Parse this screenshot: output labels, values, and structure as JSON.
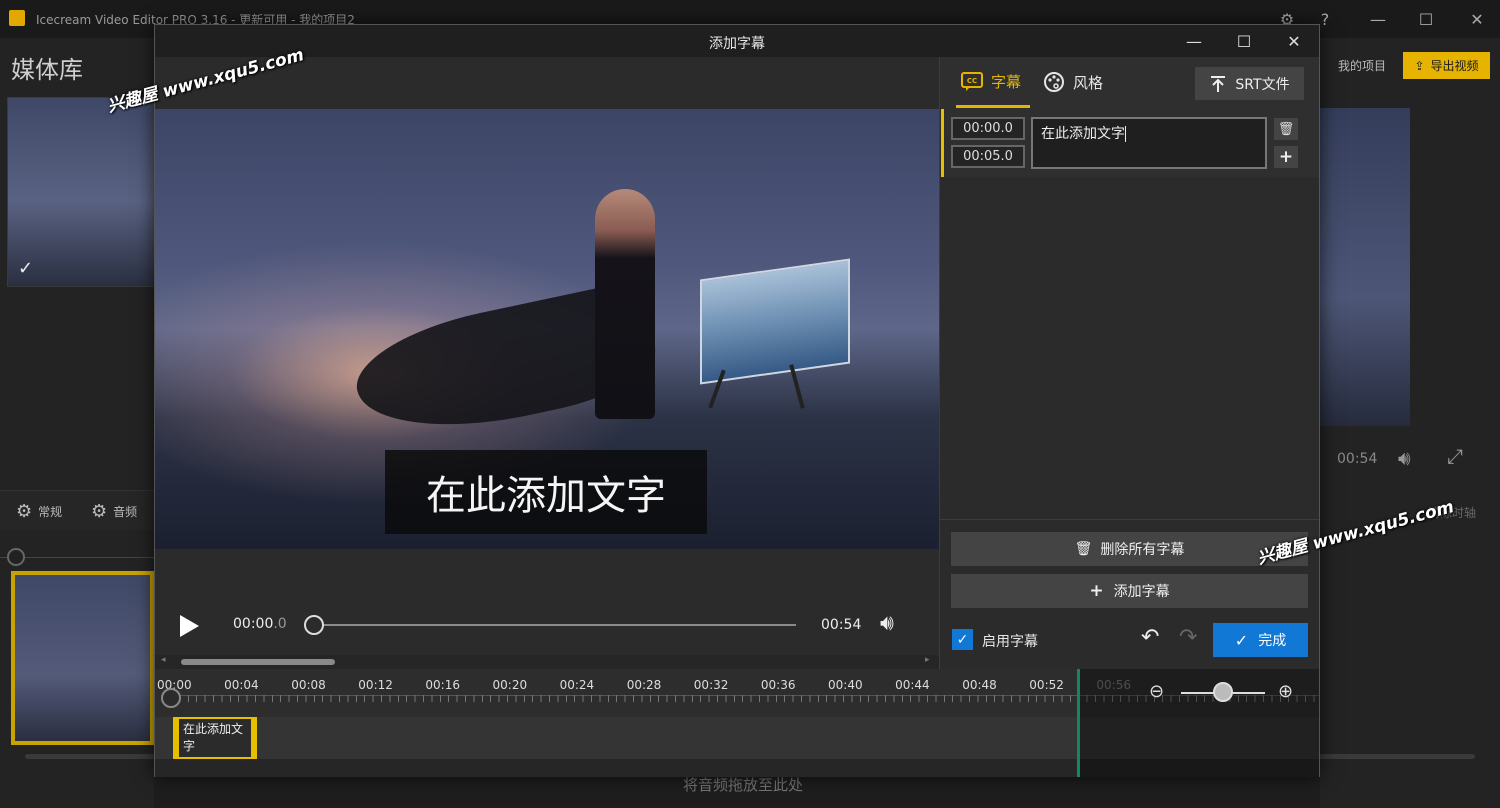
{
  "app": {
    "title": "Icecream Video Editor PRO 3.16   -   更新可用   -     我的项目2",
    "library_title": "媒体库",
    "settings": [
      "常规",
      "音频"
    ],
    "my_projects": "我的项目",
    "export_label": "导出视频",
    "preview_time": "00:54",
    "clear_timeline": "清除时轴",
    "drop_audio_hint": "将音频拖放至此处",
    "window_controls": [
      "minimize-icon",
      "maximize-icon",
      "close-icon"
    ]
  },
  "watermarks": [
    "兴趣屋 www.xqu5.com",
    "兴趣屋 www.xqu5.com"
  ],
  "dialog": {
    "title": "添加字幕",
    "tabs": [
      {
        "label": "字幕",
        "icon": "cc-icon",
        "active": true
      },
      {
        "label": "风格",
        "icon": "palette-icon",
        "active": false
      }
    ],
    "srt_button": "SRT文件",
    "subtitles": [
      {
        "start": "00:00.0",
        "end": "00:05.0",
        "text": "在此添加文字"
      }
    ],
    "preview_caption": "在此添加文字",
    "player": {
      "current_time_main": "00:00",
      "current_time_fraction": ".0",
      "duration": "00:54",
      "progress": 0.0
    },
    "delete_all_label": "删除所有字幕",
    "add_subtitle_label": "添加字幕",
    "enable_subtitles_label": "启用字幕",
    "enable_subtitles_checked": true,
    "done_label": "完成",
    "timeline": {
      "ticks": [
        "00:00",
        "00:04",
        "00:08",
        "00:12",
        "00:16",
        "00:20",
        "00:24",
        "00:28",
        "00:32",
        "00:36",
        "00:40",
        "00:44",
        "00:48",
        "00:52",
        "00:56"
      ],
      "clip_text": "在此添加文字",
      "zoom_level": 0.5
    }
  },
  "colors": {
    "accent_yellow": "#e6b400",
    "primary_blue": "#1178d6",
    "playhead_green": "#0f8a5f"
  }
}
